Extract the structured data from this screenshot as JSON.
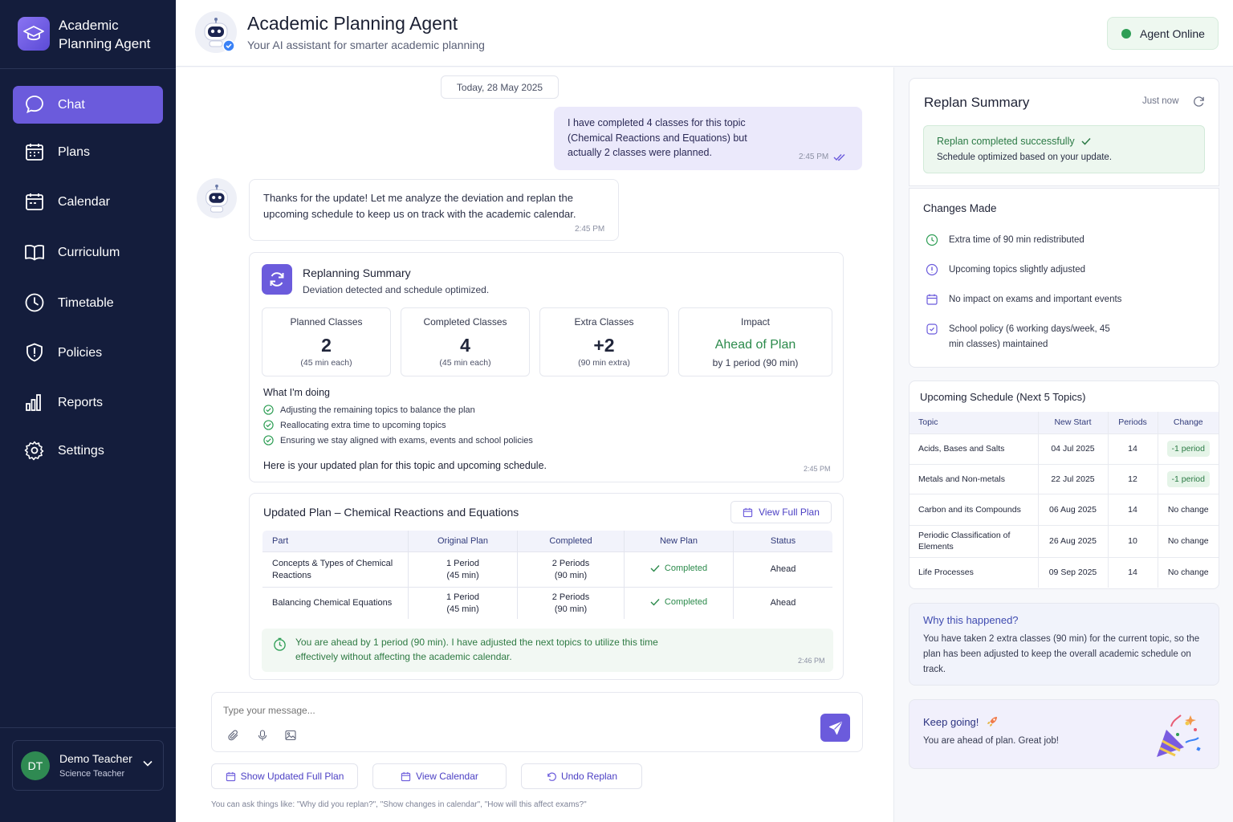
{
  "brand": {
    "title": "Academic Planning Agent"
  },
  "nav": [
    {
      "label": "Chat",
      "icon": "chat-icon",
      "active": true
    },
    {
      "label": "Plans",
      "icon": "plans-icon"
    },
    {
      "label": "Calendar",
      "icon": "calendar-icon"
    },
    {
      "label": "Curriculum",
      "icon": "book-icon"
    },
    {
      "label": "Timetable",
      "icon": "clock-icon"
    },
    {
      "label": "Policies",
      "icon": "shield-icon"
    },
    {
      "label": "Reports",
      "icon": "bar-chart-icon"
    },
    {
      "label": "Settings",
      "icon": "gear-icon"
    }
  ],
  "user": {
    "initials": "DT",
    "name": "Demo Teacher",
    "role": "Science Teacher"
  },
  "header": {
    "title": "Academic Planning Agent",
    "subtitle": "Your AI assistant for smarter academic planning",
    "status": "Agent Online"
  },
  "chat": {
    "date": "Today, 28 May 2025",
    "user_message": {
      "text": "I have completed 4 classes for this topic (Chemical Reactions and Equations) but actually 2 classes were planned.",
      "time": "2:45 PM"
    },
    "bot_message": {
      "text": "Thanks for the update! Let me analyze the deviation and replan the upcoming schedule to keep us on track with the academic calendar.",
      "time": "2:45 PM"
    },
    "replan": {
      "title": "Replanning Summary",
      "subtitle": "Deviation detected and schedule optimized.",
      "stats": [
        {
          "label": "Planned Classes",
          "value": "2",
          "sub": "(45 min each)"
        },
        {
          "label": "Completed Classes",
          "value": "4",
          "sub": "(45 min each)"
        },
        {
          "label": "Extra Classes",
          "value": "+2",
          "sub": "(90 min extra)"
        },
        {
          "label": "Impact",
          "value": "Ahead of Plan",
          "sub": "by 1 period (90 min)"
        }
      ],
      "doing_title": "What I'm doing",
      "doing": [
        "Adjusting the remaining topics to balance the plan",
        "Reallocating extra time to upcoming topics",
        "Ensuring we stay aligned with exams, events and school policies"
      ],
      "footer": "Here is your updated plan for this topic and upcoming schedule.",
      "time": "2:45 PM"
    },
    "plan": {
      "title": "Updated Plan – Chemical Reactions and Equations",
      "view_full": "View Full Plan",
      "headers": [
        "Part",
        "Original Plan",
        "Completed",
        "New Plan",
        "Status"
      ],
      "rows": [
        {
          "part": "Concepts & Types of Chemical Reactions",
          "orig1": "1 Period",
          "orig2": "(45 min)",
          "comp1": "2 Periods",
          "comp2": "(90 min)",
          "new": "Completed",
          "status": "Ahead"
        },
        {
          "part": "Balancing Chemical Equations",
          "orig1": "1 Period",
          "orig2": "(45 min)",
          "comp1": "2 Periods",
          "comp2": "(90 min)",
          "new": "Completed",
          "status": "Ahead"
        }
      ],
      "note": "You are ahead by 1 period (90 min). I have adjusted the next topics to utilize this time effectively without affecting the academic calendar.",
      "note_time": "2:46 PM"
    },
    "input_placeholder": "Type your message...",
    "quick": [
      "Show Updated Full Plan",
      "View Calendar",
      "Undo Replan"
    ],
    "hint": "You can ask things like: \"Why did you replan?\", \"Show changes in calendar\", \"How will this affect exams?\""
  },
  "right": {
    "summary": {
      "title": "Replan Summary",
      "time": "Just now",
      "success": "Replan completed successfully",
      "success_sub": "Schedule optimized based on your update."
    },
    "changes_title": "Changes Made",
    "changes": [
      {
        "icon": "clock-icon",
        "text": "Extra time of 90 min redistributed"
      },
      {
        "icon": "alert-icon",
        "text": "Upcoming topics slightly adjusted"
      },
      {
        "icon": "calendar-icon",
        "text": "No impact on exams and important events"
      },
      {
        "icon": "policy-icon",
        "text": "School policy (6 working days/week, 45 min classes) maintained"
      }
    ],
    "schedule_title": "Upcoming Schedule (Next 5 Topics)",
    "schedule_headers": [
      "Topic",
      "New Start",
      "Periods",
      "Change"
    ],
    "schedule": [
      {
        "topic": "Acids, Bases and Salts",
        "start": "04 Jul 2025",
        "periods": "14",
        "change": "-1 period"
      },
      {
        "topic": "Metals and Non-metals",
        "start": "22 Jul 2025",
        "periods": "12",
        "change": "-1 period"
      },
      {
        "topic": "Carbon and its Compounds",
        "start": "06 Aug 2025",
        "periods": "14",
        "change": "No change"
      },
      {
        "topic": "Periodic Classification of Elements",
        "start": "26 Aug 2025",
        "periods": "10",
        "change": "No change"
      },
      {
        "topic": "Life Processes",
        "start": "09 Sep 2025",
        "periods": "14",
        "change": "No change"
      }
    ],
    "why_title": "Why this happened?",
    "why_text": "You have taken 2 extra classes (90 min) for the current topic, so the plan has been adjusted to keep the overall academic schedule on track.",
    "keep_title": "Keep going!",
    "keep_text": "You are ahead of plan. Great job!"
  },
  "colors": {
    "accent": "#6b5bdc",
    "sidebar": "#141d3c",
    "success": "#2e9e55"
  }
}
